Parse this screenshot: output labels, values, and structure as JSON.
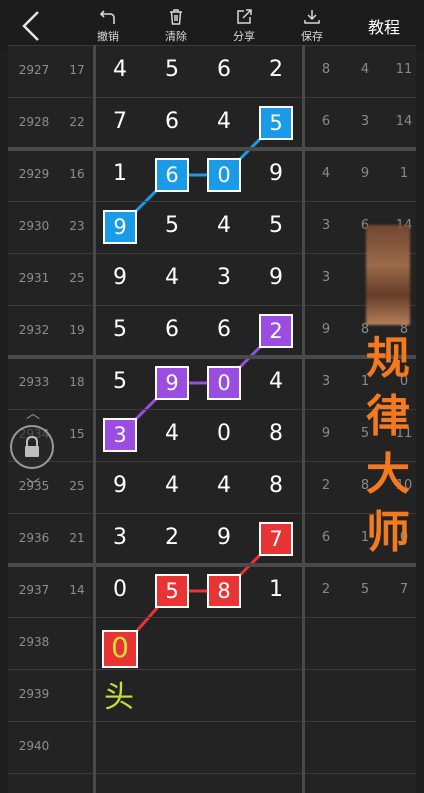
{
  "toolbar": {
    "back_icon": "chevron-left-icon",
    "buttons": [
      {
        "label": "撤销",
        "icon": "undo-icon"
      },
      {
        "label": "清除",
        "icon": "trash-icon"
      },
      {
        "label": "分享",
        "icon": "share-icon"
      },
      {
        "label": "保存",
        "icon": "download-icon"
      }
    ],
    "tutorial_label": "教程"
  },
  "rows": [
    {
      "issue": "2927",
      "sum": "17",
      "digits": [
        "4",
        "5",
        "6",
        "2"
      ],
      "tail": [
        "8",
        "4",
        "11"
      ]
    },
    {
      "issue": "2928",
      "sum": "22",
      "digits": [
        "7",
        "6",
        "4",
        "5"
      ],
      "tail": [
        "6",
        "3",
        "14"
      ]
    },
    {
      "issue": "2929",
      "sum": "16",
      "digits": [
        "1",
        "6",
        "0",
        "9"
      ],
      "tail": [
        "4",
        "9",
        "1"
      ]
    },
    {
      "issue": "2930",
      "sum": "23",
      "digits": [
        "9",
        "5",
        "4",
        "5"
      ],
      "tail": [
        "3",
        "6",
        "14"
      ]
    },
    {
      "issue": "2931",
      "sum": "25",
      "digits": [
        "9",
        "4",
        "3",
        "9"
      ],
      "tail": [
        "3",
        "",
        ""
      ]
    },
    {
      "issue": "2932",
      "sum": "19",
      "digits": [
        "5",
        "6",
        "6",
        "2"
      ],
      "tail": [
        "9",
        "8",
        "8"
      ]
    },
    {
      "issue": "2933",
      "sum": "18",
      "digits": [
        "5",
        "9",
        "0",
        "4"
      ],
      "tail": [
        "3",
        "1",
        "0"
      ]
    },
    {
      "issue": "2934",
      "sum": "15",
      "digits": [
        "3",
        "4",
        "0",
        "8"
      ],
      "tail": [
        "9",
        "5",
        "11"
      ]
    },
    {
      "issue": "2935",
      "sum": "25",
      "digits": [
        "9",
        "4",
        "4",
        "8"
      ],
      "tail": [
        "2",
        "8",
        "10"
      ]
    },
    {
      "issue": "2936",
      "sum": "21",
      "digits": [
        "3",
        "2",
        "9",
        "7"
      ],
      "tail": [
        "6",
        "1",
        "0"
      ]
    },
    {
      "issue": "2937",
      "sum": "14",
      "digits": [
        "0",
        "5",
        "8",
        "1"
      ],
      "tail": [
        "2",
        "5",
        "7"
      ]
    },
    {
      "issue": "2938",
      "sum": "",
      "digits": [
        "",
        "",
        "",
        ""
      ],
      "tail": [
        "",
        "",
        ""
      ]
    },
    {
      "issue": "2939",
      "sum": "",
      "digits": [
        "",
        "",
        "",
        ""
      ],
      "tail": [
        "",
        "",
        ""
      ]
    },
    {
      "issue": "2940",
      "sum": "",
      "digits": [
        "",
        "",
        "",
        ""
      ],
      "tail": [
        "",
        "",
        ""
      ]
    }
  ],
  "highlights": [
    {
      "row": 1,
      "col": 3,
      "value": "5",
      "color": "#1a9be8"
    },
    {
      "row": 2,
      "col": 1,
      "value": "6",
      "color": "#1a9be8"
    },
    {
      "row": 2,
      "col": 2,
      "value": "0",
      "color": "#1a9be8"
    },
    {
      "row": 3,
      "col": 0,
      "value": "9",
      "color": "#1a9be8"
    },
    {
      "row": 5,
      "col": 3,
      "value": "2",
      "color": "#9a4de0"
    },
    {
      "row": 6,
      "col": 1,
      "value": "9",
      "color": "#9a4de0"
    },
    {
      "row": 6,
      "col": 2,
      "value": "0",
      "color": "#9a4de0"
    },
    {
      "row": 7,
      "col": 0,
      "value": "3",
      "color": "#9a4de0"
    },
    {
      "row": 9,
      "col": 3,
      "value": "7",
      "color": "#e93434"
    },
    {
      "row": 10,
      "col": 1,
      "value": "5",
      "color": "#e93434"
    },
    {
      "row": 10,
      "col": 2,
      "value": "8",
      "color": "#e93434"
    }
  ],
  "head_marker": {
    "digit": "0",
    "label": "头",
    "color": "#c4e03c",
    "fill": "#e93434"
  },
  "watermark": "规律大师",
  "watermark_color": "#f47a20",
  "lock_icon": "lock-icon"
}
